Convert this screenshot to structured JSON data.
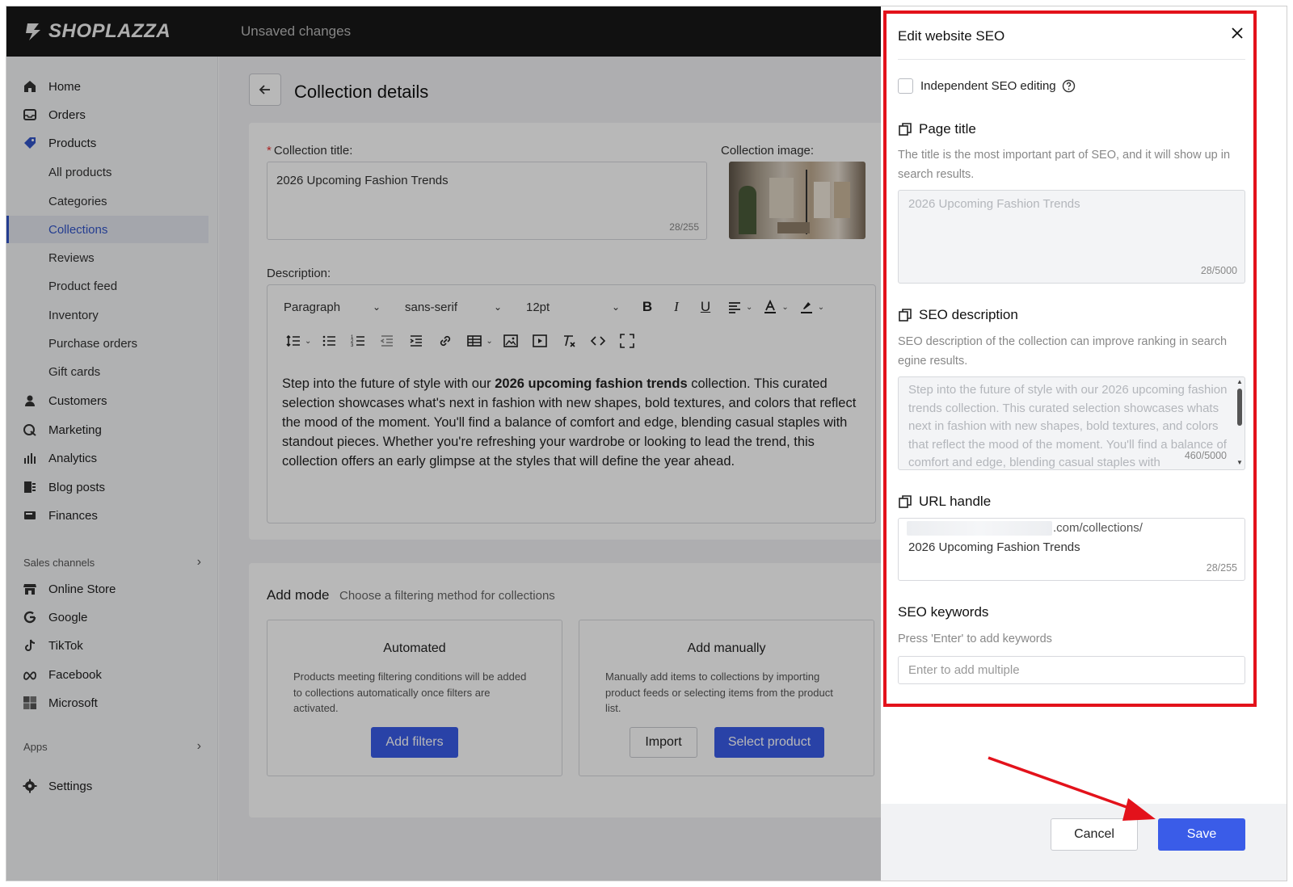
{
  "topbar": {
    "brand": "SHOPLAZZA",
    "status": "Unsaved changes"
  },
  "sidebar": {
    "items": [
      {
        "label": "Home",
        "icon": "home-icon"
      },
      {
        "label": "Orders",
        "icon": "orders-icon"
      },
      {
        "label": "Products",
        "icon": "tag-icon"
      }
    ],
    "product_sub": [
      "All products",
      "Categories",
      "Collections",
      "Reviews",
      "Product feed",
      "Inventory",
      "Purchase orders",
      "Gift cards"
    ],
    "items2": [
      {
        "label": "Customers",
        "icon": "user-icon"
      },
      {
        "label": "Marketing",
        "icon": "marketing-icon"
      },
      {
        "label": "Analytics",
        "icon": "chart-icon"
      },
      {
        "label": "Blog posts",
        "icon": "blog-icon"
      },
      {
        "label": "Finances",
        "icon": "wallet-icon"
      }
    ],
    "sales_channels_label": "Sales channels",
    "channels": [
      {
        "label": "Online Store",
        "icon": "store-icon"
      },
      {
        "label": "Google",
        "icon": "google-icon"
      },
      {
        "label": "TikTok",
        "icon": "tiktok-icon"
      },
      {
        "label": "Facebook",
        "icon": "meta-icon"
      },
      {
        "label": "Microsoft",
        "icon": "microsoft-icon"
      }
    ],
    "apps_label": "Apps",
    "settings_label": "Settings"
  },
  "main": {
    "page_title": "Collection details",
    "collection_title_label": "Collection title:",
    "collection_title_value": "2026 Upcoming Fashion Trends",
    "collection_title_counter": "28/255",
    "collection_image_label": "Collection image:",
    "description_label": "Description:",
    "toolbar": {
      "block_format": "Paragraph",
      "font_family": "sans-serif",
      "font_size": "12pt"
    },
    "description_pre": "Step into the future of style with our ",
    "description_bold": "2026 upcoming fashion trends",
    "description_post": " collection. This curated selection showcases what's next in fashion with new shapes, bold textures, and colors that reflect the mood of the moment. You'll find a balance of comfort and edge, blending casual staples with standout pieces. Whether you're refreshing your wardrobe or looking to lead the trend, this collection offers an early glimpse at the styles that will define the year ahead.",
    "add_mode_title": "Add mode",
    "add_mode_subtitle": "Choose a filtering method for collections",
    "automated": {
      "title": "Automated",
      "desc": "Products meeting filtering conditions will be added to collections automatically once filters are activated.",
      "button": "Add filters"
    },
    "manual": {
      "title": "Add manually",
      "desc": "Manually add items to collections by importing product feeds or selecting items from the product list.",
      "import_button": "Import",
      "select_button": "Select product"
    }
  },
  "seo_drawer": {
    "title": "Edit website SEO",
    "independent_label": "Independent SEO editing",
    "page_title_heading": "Page title",
    "page_title_desc": "The title is the most important part of SEO, and it will show up in search results.",
    "page_title_value": "2026 Upcoming Fashion Trends",
    "page_title_counter": "28/5000",
    "seo_desc_heading": "SEO description",
    "seo_desc_desc": "SEO description of the collection can improve ranking in search egine results.",
    "seo_desc_value": "Step into the future of style with our 2026 upcoming fashion trends collection. This curated selection showcases whats next in fashion with new shapes, bold textures, and colors that reflect the mood of the moment. You'll find a balance of comfort and edge, blending casual staples with",
    "seo_desc_counter": "460/5000",
    "url_heading": "URL handle",
    "url_suffix": ".com/collections/",
    "url_value": "2026 Upcoming Fashion Trends",
    "url_counter": "28/255",
    "keywords_heading": "SEO keywords",
    "keywords_desc": "Press 'Enter' to add keywords",
    "keywords_placeholder": "Enter to add multiple",
    "cancel_label": "Cancel",
    "save_label": "Save"
  },
  "colors": {
    "primary": "#3a5ce8",
    "highlight": "#e3121b",
    "topbar": "#181818"
  }
}
